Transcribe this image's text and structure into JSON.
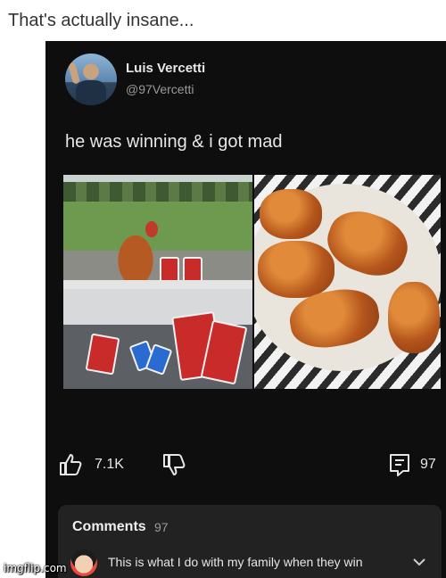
{
  "caption": "That's actually insane...",
  "post": {
    "user_name": "Luis Vercetti",
    "user_handle": "@97Vercetti",
    "text": "he was winning & i got mad",
    "likes": "7.1K",
    "comments_count": "97"
  },
  "comments": {
    "title": "Comments",
    "count": "97",
    "preview_text": "This is what I do with my family when they win"
  },
  "watermark": "imgflip.com",
  "colors": {
    "post_background": "#0e0e0e",
    "comments_panel": "#222222",
    "text_primary": "#e6e6e6",
    "text_secondary": "#9a9a9a"
  }
}
